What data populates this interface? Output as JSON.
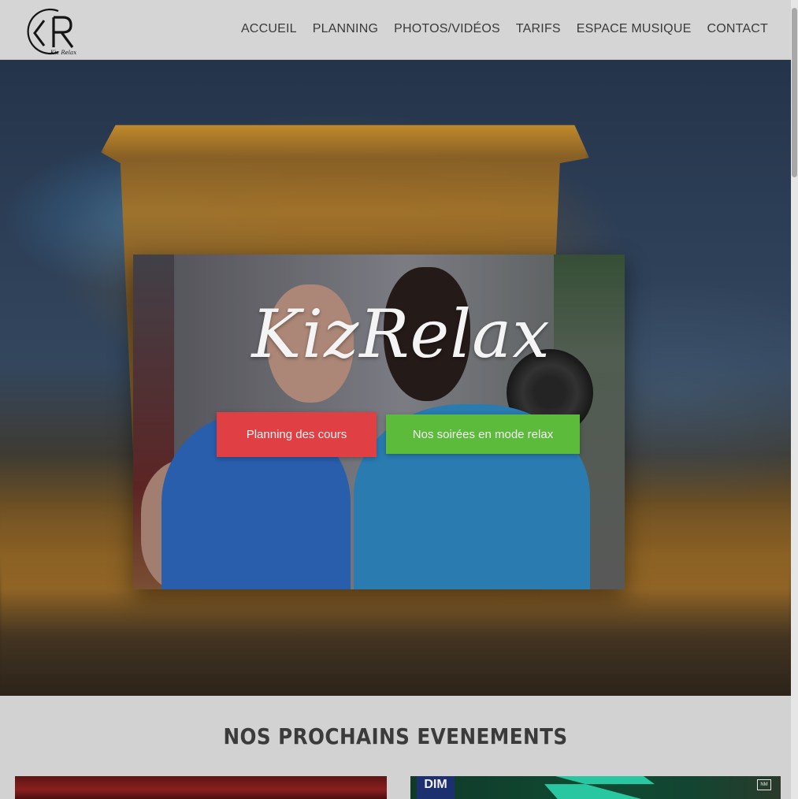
{
  "header": {
    "logo": {
      "monogram": "KR",
      "wordmark": "Kiz Relax"
    },
    "nav": [
      {
        "label": "ACCUEIL"
      },
      {
        "label": "PLANNING"
      },
      {
        "label": "PHOTOS/VIDÉOS"
      },
      {
        "label": "TARIFS"
      },
      {
        "label": "ESPACE MUSIQUE"
      },
      {
        "label": "CONTACT"
      }
    ]
  },
  "hero": {
    "brand_title": "KizRelax",
    "buttons": {
      "planning": "Planning des cours",
      "soirees": "Nos soirées en mode relax"
    },
    "colors": {
      "planning_button": "#e03f44",
      "soirees_button": "#5cbb3a"
    }
  },
  "events": {
    "title": "NOS PROCHAINS EVENEMENTS",
    "cards": [
      {
        "badge": ""
      },
      {
        "badge": "DIM",
        "corner_badge": "NM"
      }
    ]
  }
}
